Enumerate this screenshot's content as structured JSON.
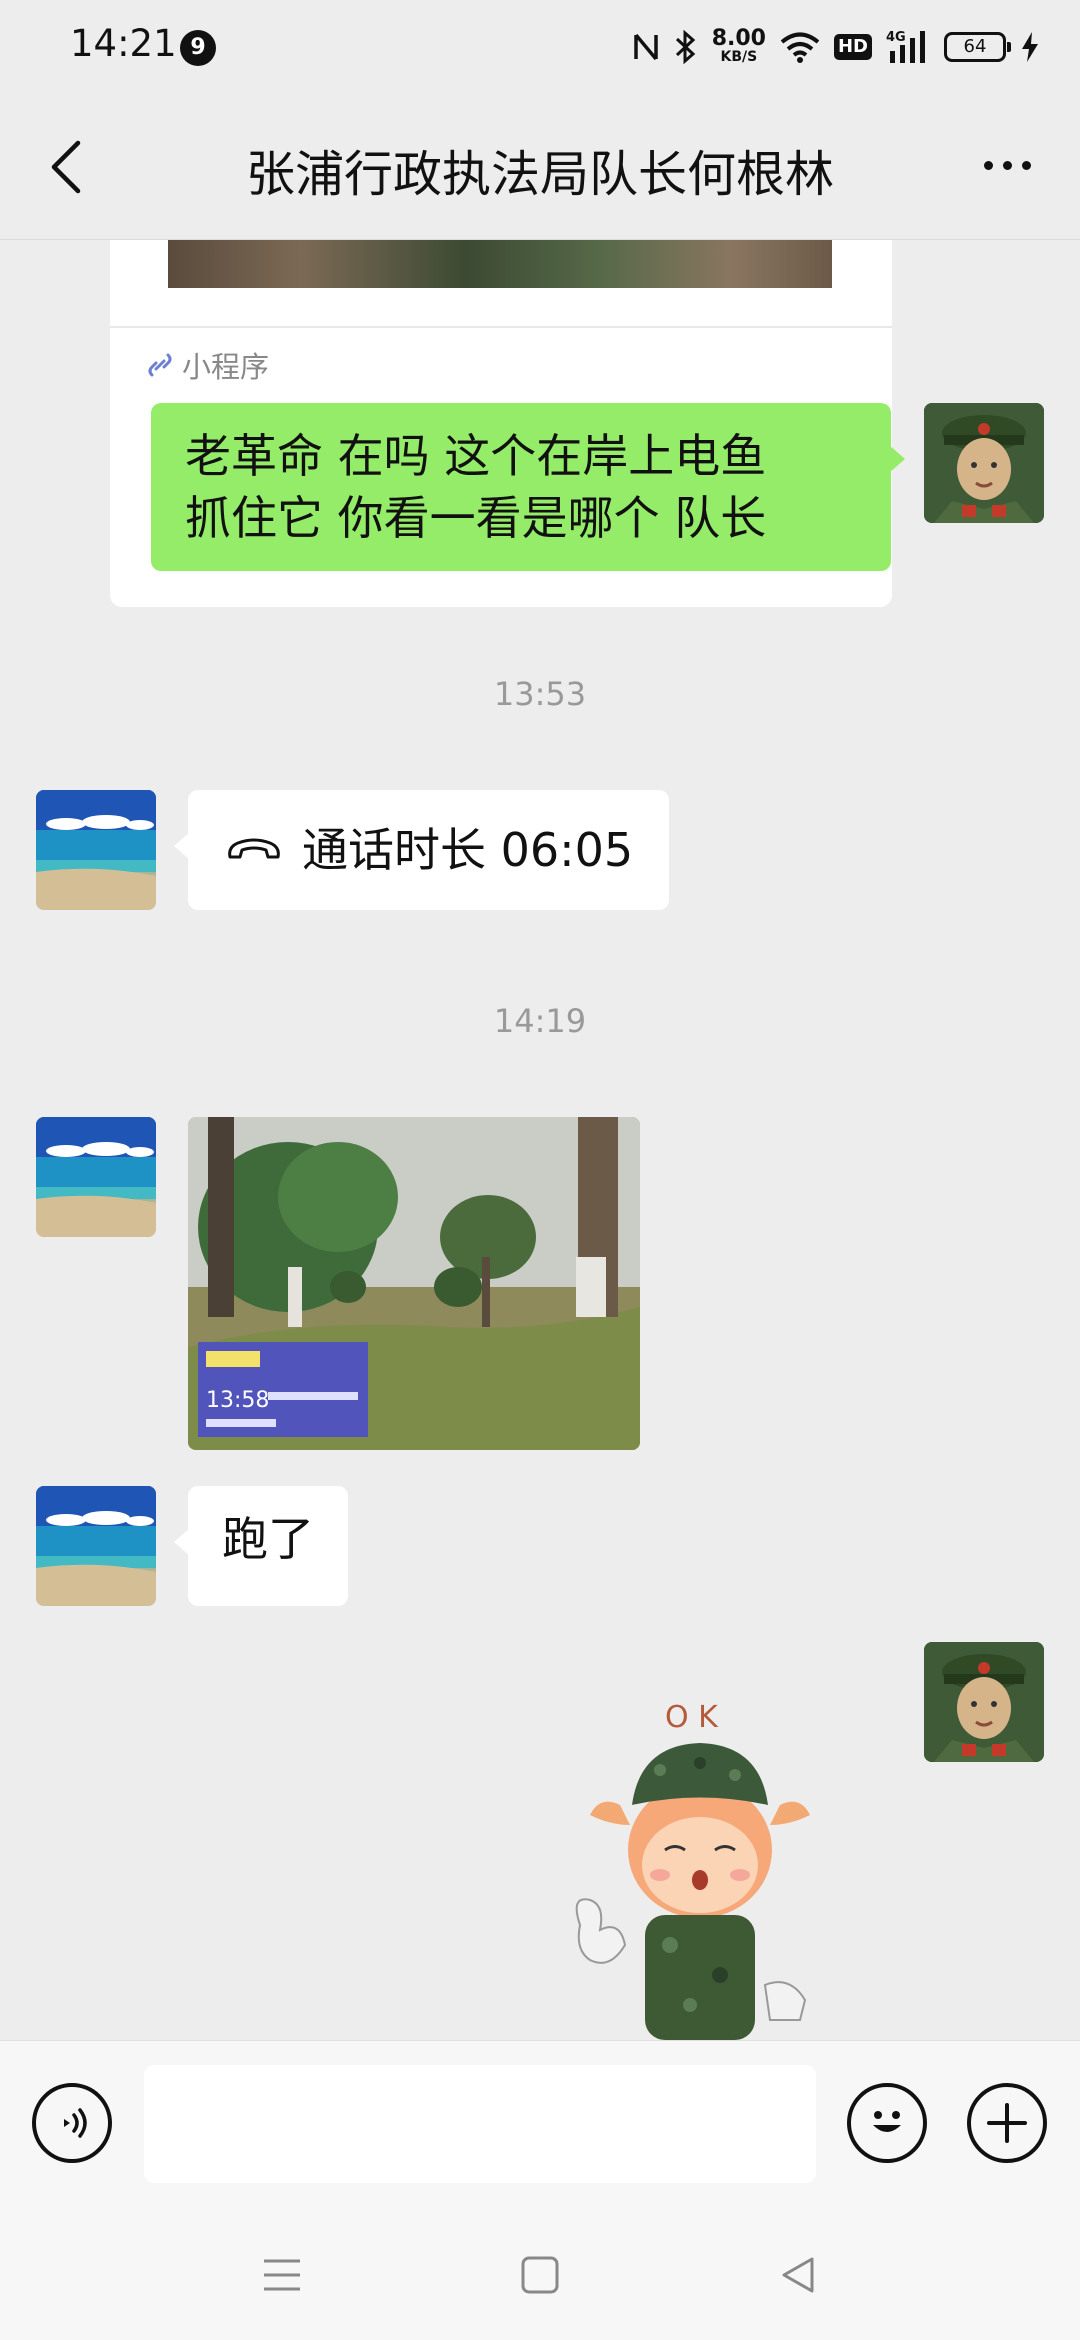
{
  "status_bar": {
    "time": "14:21",
    "notification_count": "9",
    "net_speed_value": "8.00",
    "net_speed_unit": "KB/S",
    "hd_label": "HD",
    "network_label": "4G",
    "battery_level": "64"
  },
  "header": {
    "title": "张浦行政执法局队长何根林"
  },
  "messages": {
    "mini_program_label": "小程序",
    "sent_text": "老革命 在吗 这个在岸上电鱼\n抓住它 你看一看是哪个 队长",
    "timestamp_1": "13:53",
    "call_duration": "通话时长 06:05",
    "timestamp_2": "14:19",
    "photo_overlay_time": "13:58",
    "reply_text": "跑了",
    "sticker_text": "O K"
  },
  "input_bar": {
    "placeholder": ""
  },
  "colors": {
    "background": "#ededed",
    "sent_bubble": "#95ec69",
    "received_bubble": "#ffffff",
    "timestamp_text": "#999999"
  },
  "icons": {
    "back": "chevron-left-icon",
    "more": "more-dots-icon",
    "voice": "voice-icon",
    "emoji": "emoji-icon",
    "plus": "plus-icon",
    "call": "phone-hangup-icon",
    "mini_program": "link-icon"
  }
}
